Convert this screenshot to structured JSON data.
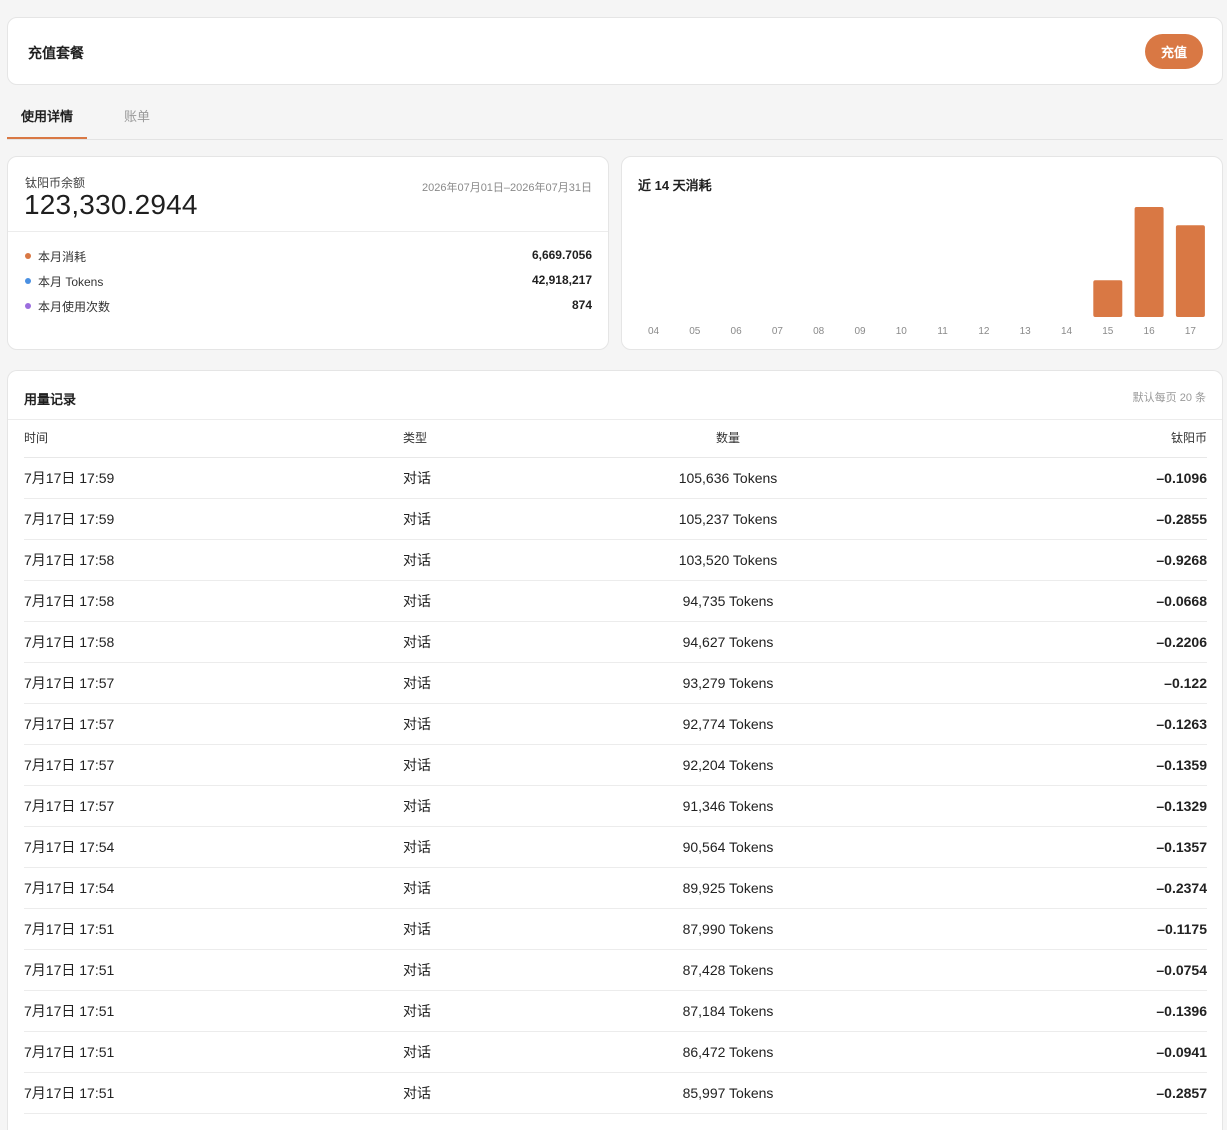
{
  "topbar": {
    "title": "充值套餐",
    "recharge_label": "充值"
  },
  "tabs": [
    {
      "label": "使用详情",
      "active": true
    },
    {
      "label": "账单",
      "active": false
    }
  ],
  "balance": {
    "label": "钛阳币余额",
    "value": "123,330.2944",
    "date_range": "2026年07月01日–2026年07月31日",
    "stats": [
      {
        "label": "本月消耗",
        "value": "6,669.7056",
        "dot_color": "#d97844"
      },
      {
        "label": "本月 Tokens",
        "value": "42,918,217",
        "dot_color": "#4a90e2"
      },
      {
        "label": "本月使用次数",
        "value": "874",
        "dot_color": "#9b6dde"
      }
    ]
  },
  "chart": {
    "title": "近 14 天消耗",
    "bar_color": "#d97844"
  },
  "chart_data": {
    "type": "bar",
    "title": "近 14 天消耗",
    "categories": [
      "04",
      "05",
      "06",
      "07",
      "08",
      "09",
      "10",
      "11",
      "12",
      "13",
      "14",
      "15",
      "16",
      "17"
    ],
    "values": [
      0,
      0,
      0,
      0,
      0,
      0,
      0,
      0,
      0,
      0,
      0,
      1000,
      3000,
      2500
    ],
    "xlabel": "",
    "ylabel": "",
    "grid": false
  },
  "usage": {
    "title": "用量记录",
    "page_hint": "默认每页 20 条",
    "columns": [
      "时间",
      "类型",
      "数量",
      "钛阳币"
    ],
    "rows": [
      [
        "7月17日 17:59",
        "对话",
        "105,636 Tokens",
        "–0.1096"
      ],
      [
        "7月17日 17:59",
        "对话",
        "105,237 Tokens",
        "–0.2855"
      ],
      [
        "7月17日 17:58",
        "对话",
        "103,520 Tokens",
        "–0.9268"
      ],
      [
        "7月17日 17:58",
        "对话",
        "94,735 Tokens",
        "–0.0668"
      ],
      [
        "7月17日 17:58",
        "对话",
        "94,627 Tokens",
        "–0.2206"
      ],
      [
        "7月17日 17:57",
        "对话",
        "93,279 Tokens",
        "–0.122"
      ],
      [
        "7月17日 17:57",
        "对话",
        "92,774 Tokens",
        "–0.1263"
      ],
      [
        "7月17日 17:57",
        "对话",
        "92,204 Tokens",
        "–0.1359"
      ],
      [
        "7月17日 17:57",
        "对话",
        "91,346 Tokens",
        "–0.1329"
      ],
      [
        "7月17日 17:54",
        "对话",
        "90,564 Tokens",
        "–0.1357"
      ],
      [
        "7月17日 17:54",
        "对话",
        "89,925 Tokens",
        "–0.2374"
      ],
      [
        "7月17日 17:51",
        "对话",
        "87,990 Tokens",
        "–0.1175"
      ],
      [
        "7月17日 17:51",
        "对话",
        "87,428 Tokens",
        "–0.0754"
      ],
      [
        "7月17日 17:51",
        "对话",
        "87,184 Tokens",
        "–0.1396"
      ],
      [
        "7月17日 17:51",
        "对话",
        "86,472 Tokens",
        "–0.0941"
      ],
      [
        "7月17日 17:51",
        "对话",
        "85,997 Tokens",
        "–0.2857"
      ]
    ]
  }
}
